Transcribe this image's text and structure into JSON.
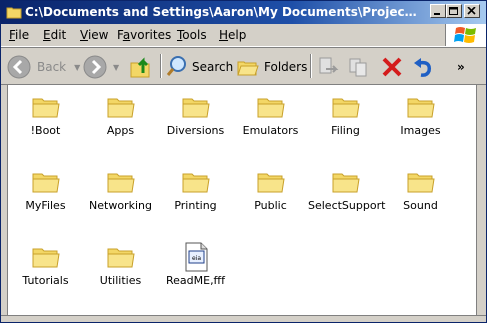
{
  "window": {
    "title": "C:\\Documents and Settings\\Aaron\\My Documents\\Projects\\Virtual ..."
  },
  "menubar": {
    "items": [
      {
        "label": "File",
        "underline": "F"
      },
      {
        "label": "Edit",
        "underline": "E"
      },
      {
        "label": "View",
        "underline": "V"
      },
      {
        "label": "Favorites",
        "underline": "a"
      },
      {
        "label": "Tools",
        "underline": "T"
      },
      {
        "label": "Help",
        "underline": "H"
      }
    ]
  },
  "toolbar": {
    "back_label": "Back",
    "search_label": "Search",
    "folders_label": "Folders",
    "more_label": "»"
  },
  "files": [
    {
      "name": "!Boot",
      "type": "folder"
    },
    {
      "name": "Apps",
      "type": "folder"
    },
    {
      "name": "Diversions",
      "type": "folder"
    },
    {
      "name": "Emulators",
      "type": "folder"
    },
    {
      "name": "Filing",
      "type": "folder"
    },
    {
      "name": "Images",
      "type": "folder"
    },
    {
      "name": "MyFiles",
      "type": "folder"
    },
    {
      "name": "Networking",
      "type": "folder"
    },
    {
      "name": "Printing",
      "type": "folder"
    },
    {
      "name": "Public",
      "type": "folder"
    },
    {
      "name": "SelectSupport",
      "type": "folder"
    },
    {
      "name": "Sound",
      "type": "folder"
    },
    {
      "name": "Tutorials",
      "type": "folder"
    },
    {
      "name": "Utilities",
      "type": "folder"
    },
    {
      "name": "ReadME,fff",
      "type": "document",
      "doc_glyph": "eia"
    }
  ],
  "colors": {
    "title_start": "#0a246a",
    "title_end": "#a6caf0",
    "folder_yellow": "#f3d766",
    "folder_dark": "#c8a02a",
    "delete_red": "#d41c1c"
  }
}
